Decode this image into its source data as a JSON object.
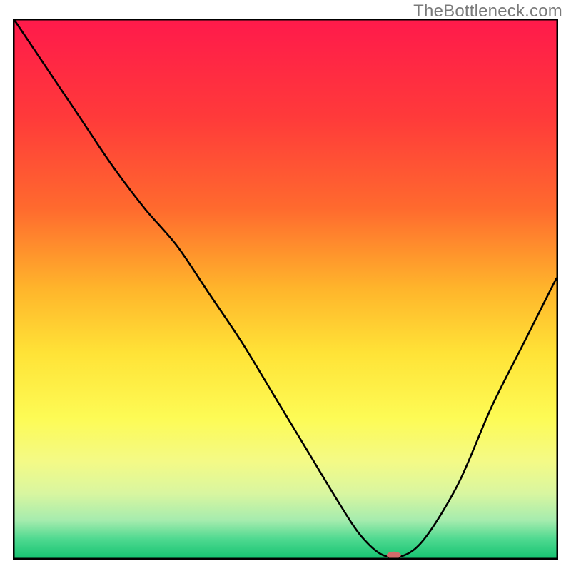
{
  "watermark": "TheBottleneck.com",
  "chart_data": {
    "type": "line",
    "title": "",
    "xlabel": "",
    "ylabel": "",
    "xlim": [
      0,
      100
    ],
    "ylim": [
      0,
      100
    ],
    "grid": false,
    "legend": false,
    "x": [
      0,
      6,
      12,
      18,
      24,
      30,
      36,
      42,
      48,
      54,
      60,
      64,
      68,
      72,
      76,
      82,
      88,
      94,
      100
    ],
    "values": [
      100,
      91,
      82,
      73,
      65,
      58,
      49,
      40,
      30,
      20,
      10,
      4,
      0.5,
      0.5,
      4,
      14,
      28,
      40,
      52
    ],
    "marker": {
      "x": 70,
      "y": 0.5,
      "color": "#d36b6b",
      "rx": 10,
      "ry": 5
    },
    "gradient_stops": [
      {
        "offset": 0.0,
        "color": "#ff1a4b"
      },
      {
        "offset": 0.18,
        "color": "#ff3a3a"
      },
      {
        "offset": 0.35,
        "color": "#ff6a2e"
      },
      {
        "offset": 0.5,
        "color": "#ffb52b"
      },
      {
        "offset": 0.62,
        "color": "#ffe337"
      },
      {
        "offset": 0.74,
        "color": "#fdfb55"
      },
      {
        "offset": 0.82,
        "color": "#f4fa86"
      },
      {
        "offset": 0.88,
        "color": "#d9f6a0"
      },
      {
        "offset": 0.93,
        "color": "#a6ecae"
      },
      {
        "offset": 0.965,
        "color": "#4fd990"
      },
      {
        "offset": 1.0,
        "color": "#18c473"
      }
    ]
  }
}
